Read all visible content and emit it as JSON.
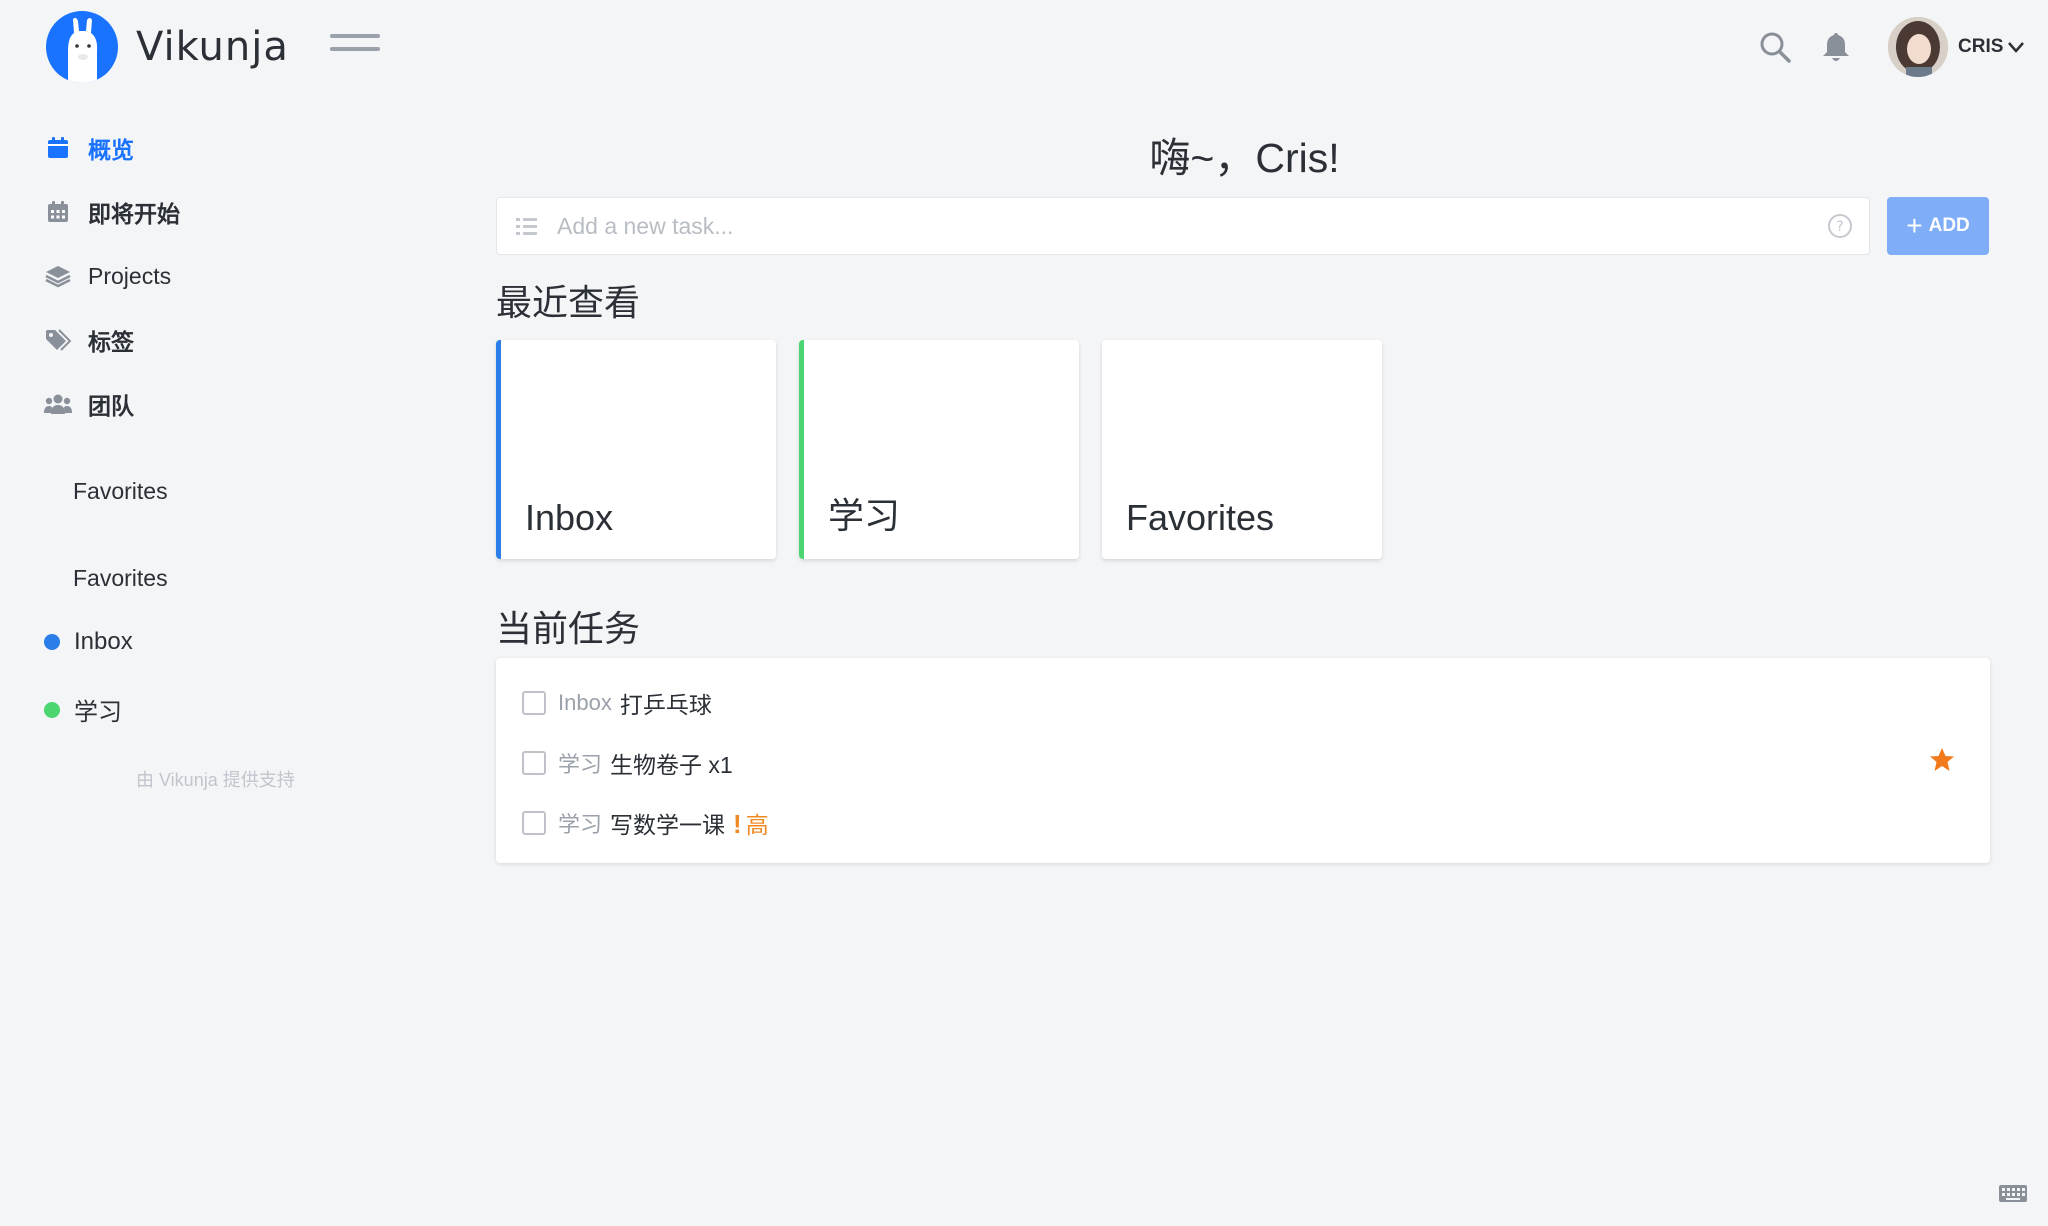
{
  "app": {
    "name": "Vikunja"
  },
  "header": {
    "username": "CRIS",
    "icons": [
      "search-icon",
      "bell-icon",
      "chevron-down-icon",
      "hamburger-menu-icon"
    ]
  },
  "sidebar": {
    "nav": [
      {
        "label": "概览",
        "icon": "calendar-icon",
        "active": true
      },
      {
        "label": "即将开始",
        "icon": "calendar-grid-icon",
        "active": false
      },
      {
        "label": "Projects",
        "icon": "layers-icon",
        "active": false
      },
      {
        "label": "标签",
        "icon": "tags-icon",
        "active": false
      },
      {
        "label": "团队",
        "icon": "users-icon",
        "active": false
      }
    ],
    "favorites_heading_1": "Favorites",
    "favorites_heading_2": "Favorites",
    "projects": [
      {
        "label": "Inbox",
        "color": "#2b7de9"
      },
      {
        "label": "学习",
        "color": "#4cd672"
      }
    ],
    "powered_by": "由 Vikunja 提供支持"
  },
  "main": {
    "greeting": "嗨~，Cris!",
    "new_task_placeholder": "Add a new task...",
    "add_button": "ADD",
    "recent_title": "最近查看",
    "recent": [
      {
        "title": "Inbox",
        "color": "#2b7de9"
      },
      {
        "title": "学习",
        "color": "#4cd672"
      },
      {
        "title": "Favorites",
        "color": ""
      }
    ],
    "current_tasks_title": "当前任务",
    "tasks": [
      {
        "project": "Inbox",
        "title": "打乒乓球",
        "favorite": false,
        "priority_label": ""
      },
      {
        "project": "学习",
        "title": "生物卷子 x1",
        "favorite": true,
        "priority_label": ""
      },
      {
        "project": "学习",
        "title": "写数学一课",
        "favorite": false,
        "priority_mark": "!",
        "priority_label": "高"
      }
    ]
  },
  "colors": {
    "accent": "#1973ff",
    "star": "#f07a1c",
    "priority_high": "#f08a24"
  }
}
